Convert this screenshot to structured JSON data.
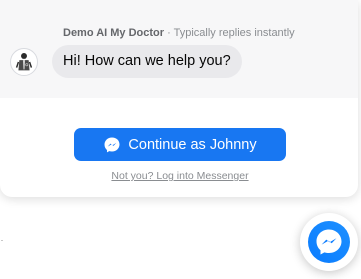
{
  "widget": {
    "page_name": "Demo AI My Doctor",
    "separator": " · ",
    "reply_time": "Typically replies instantly",
    "greeting": "Hi! How can we help you?",
    "continue_label": "Continue as Johnny",
    "login_link": "Not you? Log into Messenger"
  },
  "icons": {
    "avatar": "doctor-avatar-icon",
    "button": "messenger-icon",
    "fab": "messenger-icon"
  },
  "colors": {
    "brand_blue": "#1877f2",
    "bubble_bg": "#e9e9ec",
    "header_bg": "#f7f7f8",
    "muted_text": "#8a8d91"
  }
}
